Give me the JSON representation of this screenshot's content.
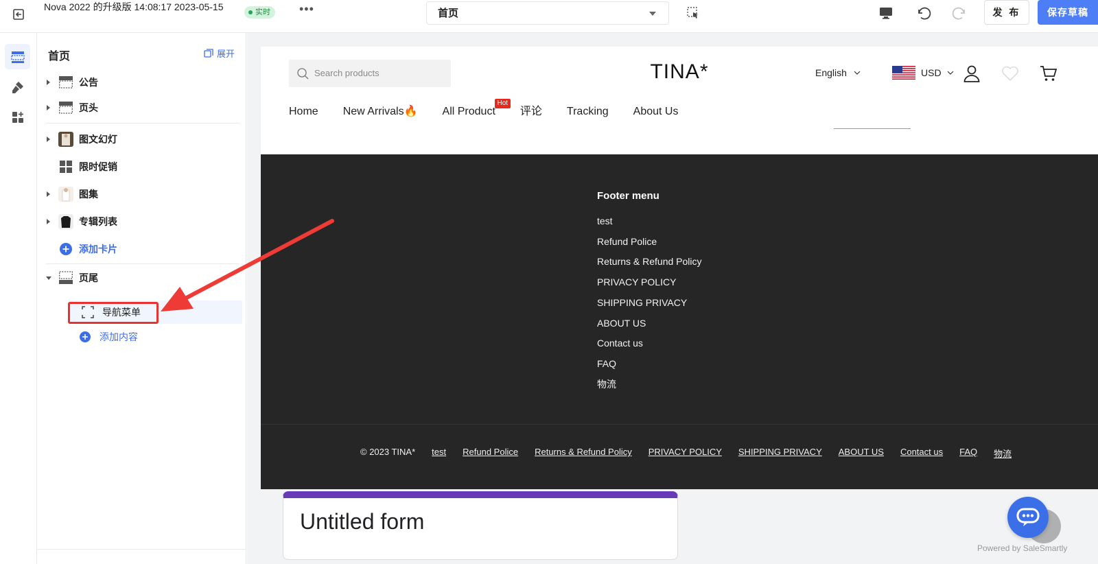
{
  "topbar": {
    "doc_title": "Nova 2022 的升级版 14:08:17 2023-05-15",
    "live_label": "实时",
    "more_label": "•••",
    "page_select_value": "首页",
    "publish_label": "发 布",
    "save_label": "保存草稿"
  },
  "panel": {
    "title": "首页",
    "expand_label": "展开",
    "items": [
      {
        "label": "公告"
      },
      {
        "label": "页头"
      },
      {
        "label": "图文幻灯"
      },
      {
        "label": "限时促销"
      },
      {
        "label": "图集"
      },
      {
        "label": "专辑列表"
      },
      {
        "label": "添加卡片"
      },
      {
        "label": "页尾"
      }
    ],
    "footer_children": [
      {
        "label": "导航菜单"
      }
    ],
    "add_content_label": "添加内容"
  },
  "store": {
    "search_placeholder": "Search products",
    "logo": "TINA*",
    "language": "English",
    "currency": "USD",
    "nav": [
      {
        "label": "Home"
      },
      {
        "label": "New Arrivals🔥"
      },
      {
        "label": "All Product",
        "badge": "Hot"
      },
      {
        "label": "评论"
      },
      {
        "label": "Tracking"
      },
      {
        "label": "About Us"
      }
    ],
    "footer": {
      "menu_heading": "Footer menu",
      "links": [
        "test",
        "Refund Police",
        "Returns & Refund Policy",
        "PRIVACY POLICY",
        "SHIPPING PRIVACY",
        "ABOUT US",
        "Contact us",
        "FAQ",
        "物流"
      ],
      "copyright": "© 2023 TINA*"
    },
    "form_title": "Untitled form",
    "powered_by": "Powered by SaleSmartly"
  },
  "colors": {
    "accent": "#4e7ef6",
    "link_blue": "#3c6ee8",
    "highlight_red": "#e8322e",
    "footer_bg": "#262626",
    "hot_badge": "#e32a1c",
    "form_accent": "#673ab7"
  }
}
